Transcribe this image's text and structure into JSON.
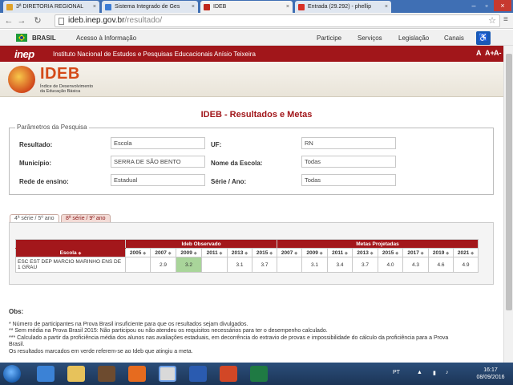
{
  "browser": {
    "tabs": [
      {
        "label": "3ª DIRETORIA REGIONAL",
        "color": "#e0a22a"
      },
      {
        "label": "Sistema Integrado de Ges",
        "color": "#3b7bd4"
      },
      {
        "label": "IDEB",
        "color": "#c0281c",
        "active": true
      },
      {
        "label": "Entrada (29.292) - phellip",
        "color": "#d93025"
      }
    ],
    "url_host": "ideb.inep.gov.br",
    "url_path": "/resultado/"
  },
  "govbar": {
    "country": "BRASIL",
    "access_info": "Acesso à Informação",
    "links": [
      "Participe",
      "Serviços",
      "Legislação",
      "Canais"
    ]
  },
  "inep": {
    "logo": "inep",
    "name": "Instituto Nacional de Estudos e Pesquisas Educacionais Anísio Teixeira",
    "font_controls": [
      "A",
      "A+",
      "A-"
    ]
  },
  "ideb": {
    "title": "IDEB",
    "subtitle_lines": [
      "Índice de Desenvolvimento",
      "da Educação Básica"
    ]
  },
  "page": {
    "heading": "IDEB - Resultados e Metas"
  },
  "params": {
    "legend": "Parâmetros da Pesquisa",
    "resultado_label": "Resultado:",
    "resultado_value": "Escola",
    "uf_label": "UF:",
    "uf_value": "RN",
    "municipio_label": "Município:",
    "municipio_value": "SERRA DE SÃO BENTO",
    "nome_escola_label": "Nome da Escola:",
    "nome_escola_value": "Todas",
    "rede_label": "Rede de ensino:",
    "rede_value": "Estadual",
    "serie_label": "Série / Ano:",
    "serie_value": "Todas"
  },
  "tabs": [
    {
      "label": "4ª série / 5º ano",
      "active": true
    },
    {
      "label": "8ª série / 9º ano",
      "active": false
    }
  ],
  "table": {
    "school_header": "Escola",
    "observed_header": "Ideb Observado",
    "projected_header": "Metas Projetadas",
    "observed_years": [
      "2005",
      "2007",
      "2009",
      "2011",
      "2013",
      "2015"
    ],
    "projected_years": [
      "2007",
      "2009",
      "2011",
      "2013",
      "2015",
      "2017",
      "2019",
      "2021"
    ],
    "rows": [
      {
        "school": "ESC EST DEP MARCIO MARINHO ENS DE 1 GRAU",
        "observed": [
          "",
          "2.9",
          "3.2",
          "",
          "3.1",
          "3.7"
        ],
        "projected": [
          "",
          "3.1",
          "3.4",
          "3.7",
          "4.0",
          "4.3",
          "4.6",
          "4.9"
        ]
      }
    ]
  },
  "obs": {
    "title": "Obs:",
    "lines": [
      "* Número de participantes na Prova Brasil insuficiente para que os resultados sejam divulgados.",
      "** Sem média na Prova Brasil 2015: Não participou ou não atendeu os requisitos necessários para ter o desempenho calculado.",
      "*** Calculado a partir da proficiência média dos alunos nas avaliações estaduais, em decorrência do extravio de provas e impossibilidade do cálculo da proficiência para a Prova",
      "Brasil.",
      "Os resultados marcados em verde referem-se ao Ideb que atingiu a meta."
    ]
  },
  "taskbar": {
    "language": "PT",
    "time": "16:17",
    "date": "08/09/2016"
  },
  "colors": {
    "inep_red": "#a1161a",
    "ideb_orange": "#d44a18",
    "meta_green": "#a9d59a"
  }
}
